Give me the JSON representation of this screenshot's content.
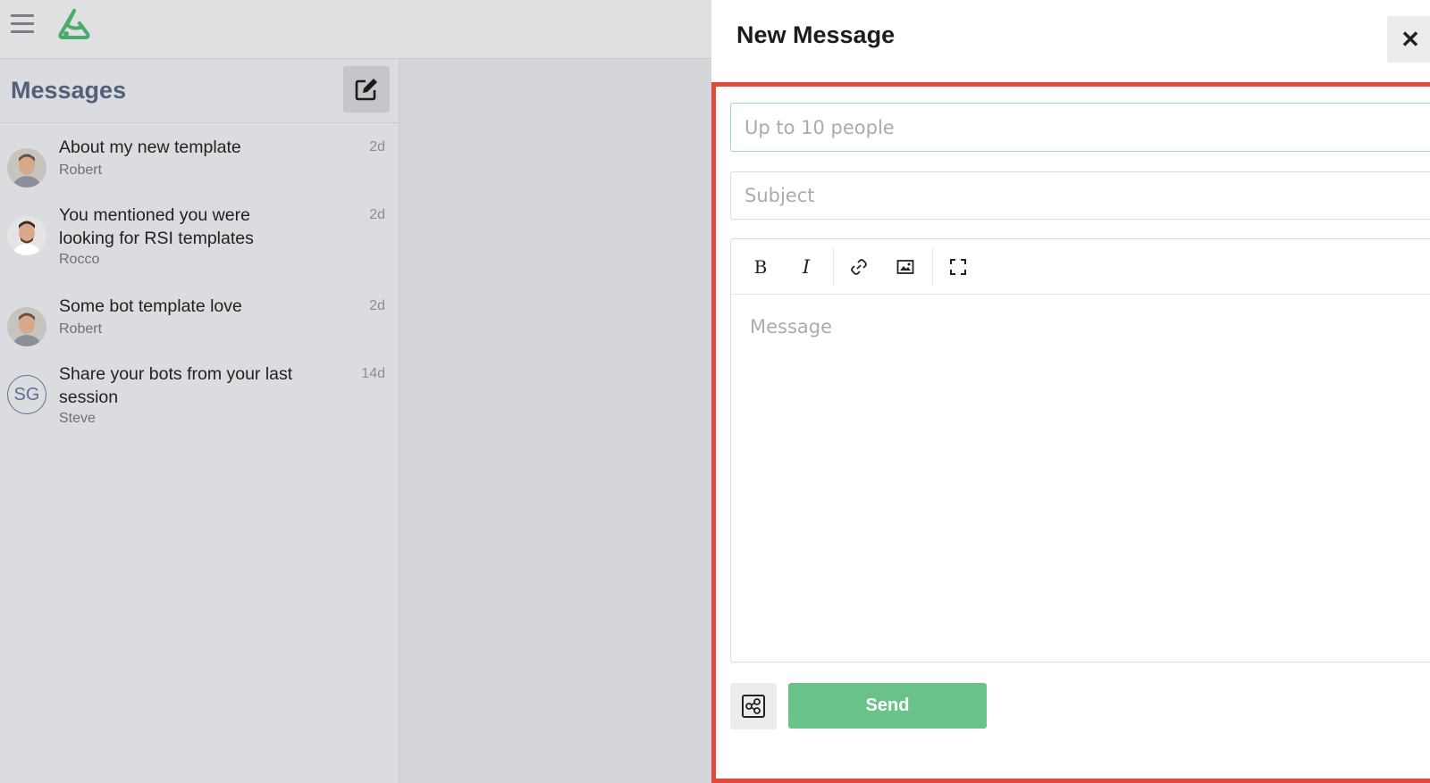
{
  "app": {
    "logo_icon": "app-logo-icon",
    "menu_icon": "hamburger-icon"
  },
  "messages": {
    "title": "Messages",
    "compose_icon": "compose-edit-icon",
    "threads": [
      {
        "subject": "About my new template",
        "sender": "Robert",
        "time": "2d",
        "avatar": "photo"
      },
      {
        "subject": "You mentioned you were looking for RSI templates",
        "sender": "Rocco",
        "time": "2d",
        "avatar": "photo"
      },
      {
        "subject": "Some bot template love",
        "sender": "Robert",
        "time": "2d",
        "avatar": "photo"
      },
      {
        "subject": "Share your bots from your last session",
        "sender": "Steve",
        "time": "14d",
        "avatar": "SG"
      }
    ]
  },
  "compose": {
    "title": "New Message",
    "close_label": "✕",
    "to_placeholder": "Up to 10 people",
    "subject_placeholder": "Subject",
    "message_placeholder": "Message",
    "toolbar": [
      "bold-icon",
      "italic-icon",
      "link-icon",
      "image-icon",
      "fullscreen-icon"
    ],
    "send_label": "Send",
    "colors": {
      "send": "#69c389",
      "highlight": "#e0493e",
      "to_border": "#9fd6bd"
    }
  }
}
